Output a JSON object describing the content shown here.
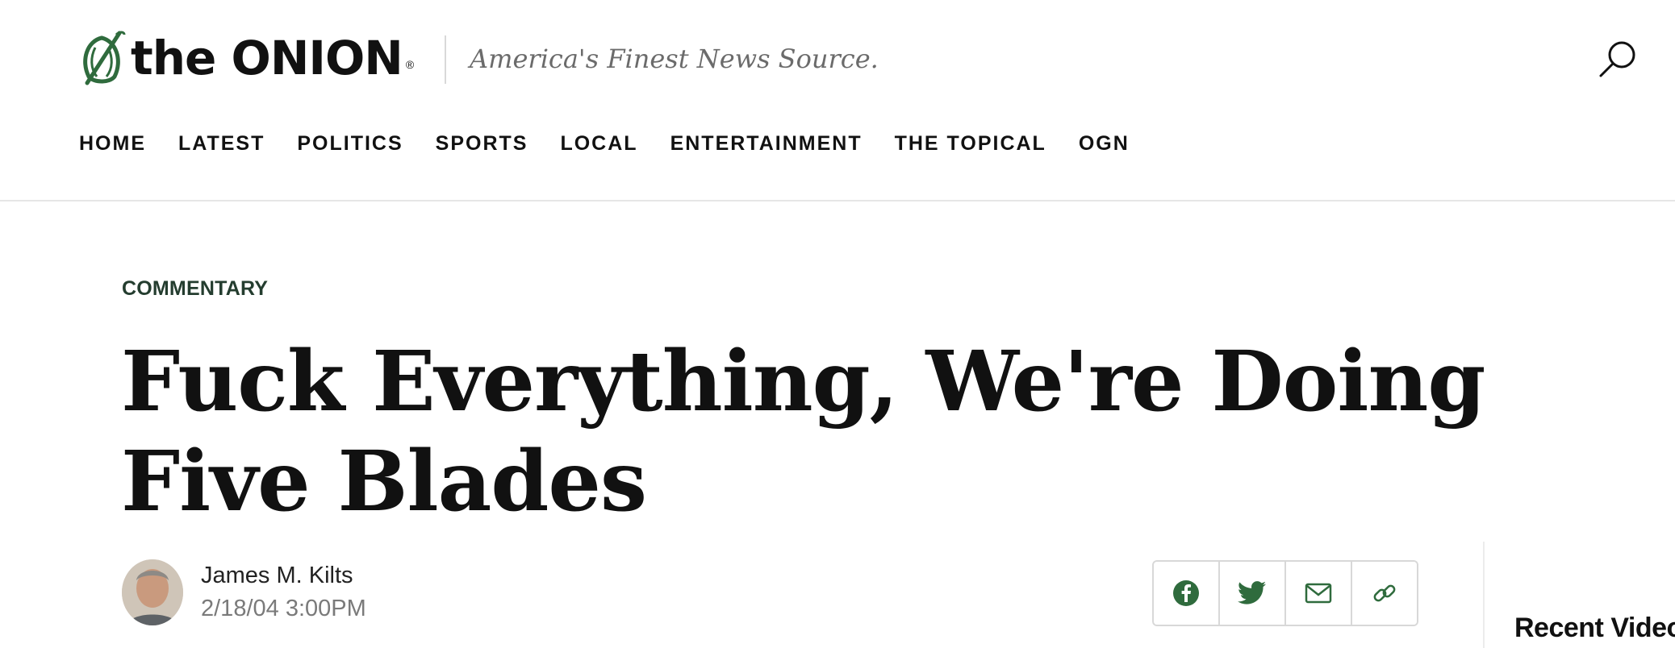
{
  "header": {
    "logo_text": "the ONION",
    "logo_reg": "®",
    "tagline": "America's Finest News Source.",
    "search_icon": "search-icon"
  },
  "nav": {
    "items": [
      "HOME",
      "LATEST",
      "POLITICS",
      "SPORTS",
      "LOCAL",
      "ENTERTAINMENT",
      "THE TOPICAL",
      "OGN"
    ]
  },
  "article": {
    "section": "COMMENTARY",
    "headline": "Fuck Everything, We're Doing Five Blades",
    "author": "James M. Kilts",
    "date": "2/18/04 3:00PM",
    "avatar": "author-avatar"
  },
  "share": {
    "icons": [
      "facebook-icon",
      "twitter-icon",
      "email-icon",
      "link-icon"
    ]
  },
  "sidebar": {
    "recent_title": "Recent Video"
  },
  "colors": {
    "brand_green": "#2f6b3d",
    "section_green": "#243d2f",
    "muted_text": "#7a7a7a"
  }
}
